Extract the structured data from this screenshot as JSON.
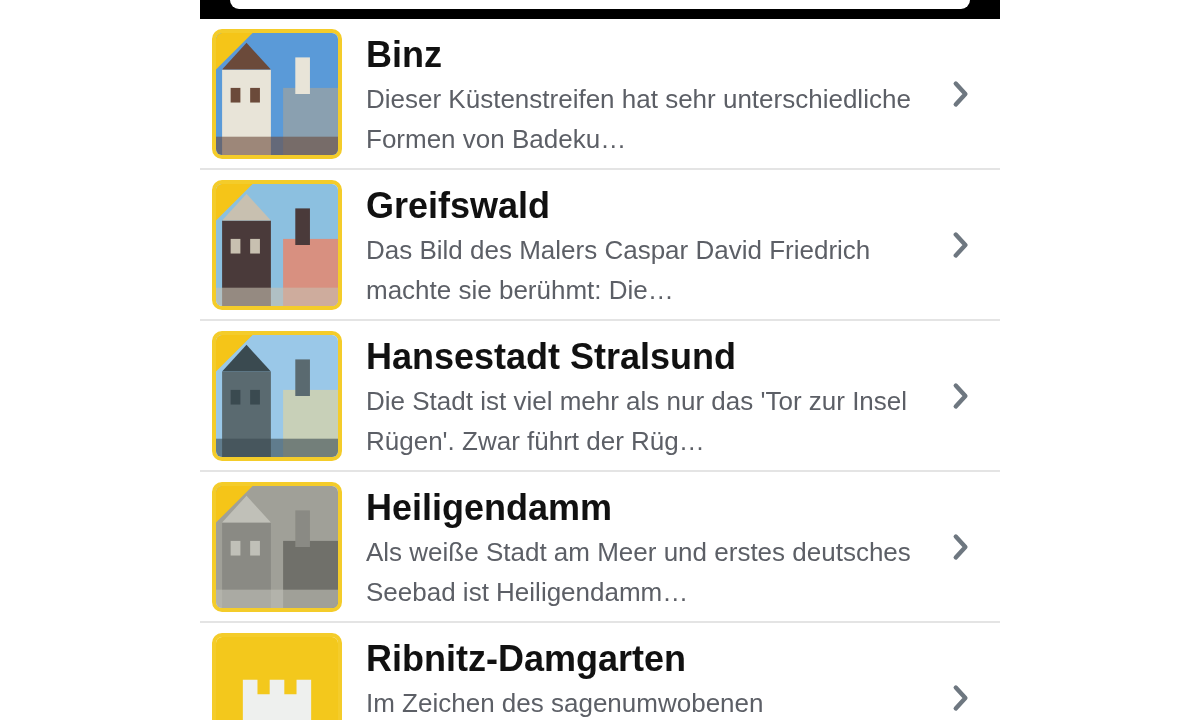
{
  "places": [
    {
      "title": "Binz",
      "description": "Dieser Küstenstreifen hat sehr unterschiedliche Formen von Badeku…"
    },
    {
      "title": "Greifswald",
      "description": "Das Bild des Malers Caspar David Friedrich machte sie berühmt: Die…"
    },
    {
      "title": "Hansestadt Stralsund",
      "description": "Die Stadt ist viel mehr als nur das 'Tor zur Insel Rügen'. Zwar führt der Rüg…"
    },
    {
      "title": "Heiligendamm",
      "description": "Als weiße Stadt am Meer und erstes deutsches Seebad ist Heiligendamm…"
    },
    {
      "title": "Ribnitz-Damgarten",
      "description": "Im Zeichen des sagenumwobenen",
      "thumbnail": {
        "kind": "tower"
      }
    }
  ]
}
